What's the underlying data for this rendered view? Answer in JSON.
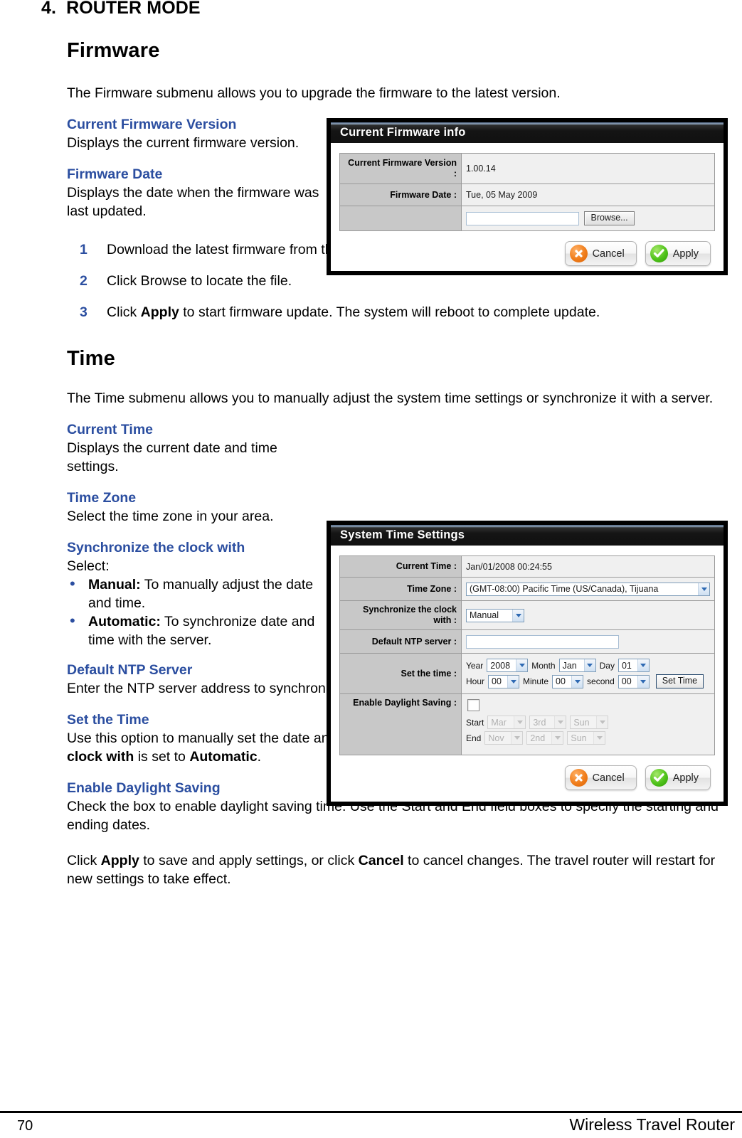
{
  "chapter": {
    "number": "4.",
    "title": "ROUTER MODE"
  },
  "firmware": {
    "heading": "Firmware",
    "intro": "The Firmware submenu allows you to upgrade the firmware to the latest version.",
    "defs": [
      {
        "term": "Current Firmware Version",
        "desc": "Displays the current firmware version."
      },
      {
        "term": "Firmware Date",
        "desc": "Displays the date when the firmware was last updated."
      }
    ],
    "steps": [
      {
        "n": "1",
        "text_before": "Download the latest firmware from the manufacturer’s website, and save it to a disk.",
        "bold": "",
        "text_after": ""
      },
      {
        "n": "2",
        "text_before": "Click Browse to locate the file.",
        "bold": "",
        "text_after": ""
      },
      {
        "n": "3",
        "text_before": "Click ",
        "bold": "Apply",
        "text_after": " to start firmware update. The system will reboot to complete update."
      }
    ]
  },
  "firmware_panel": {
    "title": "Current Firmware info",
    "rows": [
      {
        "label": "Current Firmware Version :",
        "value": "1.00.14"
      },
      {
        "label": "Firmware Date :",
        "value": "Tue, 05 May 2009"
      }
    ],
    "file_field_value": "",
    "browse_label": "Browse...",
    "cancel_label": "Cancel",
    "apply_label": "Apply"
  },
  "time": {
    "heading": "Time",
    "intro": "The Time submenu allows you to manually adjust the system time settings or synchronize it with a server.",
    "defs": [
      {
        "term": "Current Time",
        "desc": "Displays the current date and time settings."
      },
      {
        "term": "Time Zone",
        "desc": "Select the time zone in your area."
      }
    ],
    "sync": {
      "term": "Synchronize the clock with",
      "lead": "Select:",
      "bullets": [
        {
          "bold": "Manual:",
          "text": " To manually adjust the date and time."
        },
        {
          "bold": "Automatic:",
          "text": " To synchronize date and time with the server."
        }
      ]
    },
    "ntp": {
      "term": "Default NTP Server",
      "desc": "Enter the NTP server address to synchronize the date and time with."
    },
    "set_time": {
      "term": "Set the Time",
      "p1": "Use this option to manually set the date and time. This option is only available when ",
      "b1": "Synchronize the clock with",
      "p2": " is set to ",
      "b2": "Automatic",
      "p3": "."
    },
    "dst": {
      "term": "Enable Daylight Saving",
      "desc": "Check the box to enable daylight saving time. Use the Start and End field boxes to specify the starting and ending dates."
    },
    "closing": {
      "p1": "Click ",
      "b1": "Apply",
      "p2": " to save and apply settings, or click ",
      "b2": "Cancel",
      "p3": " to cancel changes. The travel router will restart for new settings to take effect."
    }
  },
  "time_panel": {
    "title": "System Time Settings",
    "labels": {
      "current_time": "Current Time :",
      "time_zone": "Time Zone :",
      "sync_with": "Synchronize the clock with :",
      "ntp": "Default NTP server :",
      "set_time": "Set the time :",
      "dst": "Enable Daylight Saving :"
    },
    "current_time_value": "Jan/01/2008 00:24:55",
    "time_zone_value": "(GMT-08:00) Pacific Time (US/Canada), Tijuana",
    "sync_with_value": "Manual",
    "ntp_value": "",
    "set_time_row1": [
      {
        "cap": "Year",
        "value": "2008"
      },
      {
        "cap": "Month",
        "value": "Jan"
      },
      {
        "cap": "Day",
        "value": "01"
      }
    ],
    "set_time_row2": [
      {
        "cap": "Hour",
        "value": "00"
      },
      {
        "cap": "Minute",
        "value": "00"
      },
      {
        "cap": "second",
        "value": "00"
      }
    ],
    "set_time_button": "Set Time",
    "dst_checked": false,
    "dst_start": {
      "cap": "Start",
      "values": [
        "Mar",
        "3rd",
        "Sun"
      ]
    },
    "dst_end": {
      "cap": "End",
      "values": [
        "Nov",
        "2nd",
        "Sun"
      ]
    },
    "cancel_label": "Cancel",
    "apply_label": "Apply"
  },
  "footer": {
    "page_number": "70",
    "document_name": "Wireless Travel Router"
  },
  "colors": {
    "heading_blue": "#2b4ea0",
    "titlebar": "#111111",
    "label_gray": "#c8c8c8",
    "value_gray": "#f0f0f0",
    "cancel_orange": "#f07d1a",
    "apply_green": "#4fc21a"
  }
}
